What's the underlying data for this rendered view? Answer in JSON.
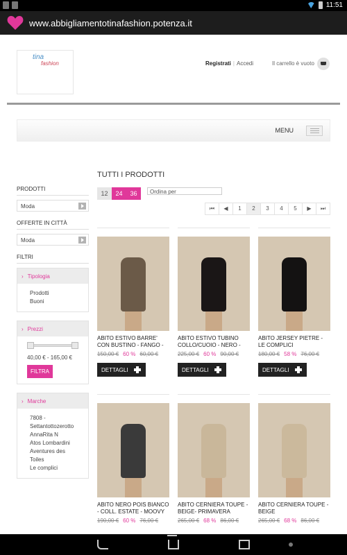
{
  "status_bar": {
    "time": "11:51"
  },
  "app": {
    "url": "www.abbigliamentotinafashion.potenza.it"
  },
  "header": {
    "logo_text_1": "tina",
    "logo_text_2": "fashion",
    "register_label": "Registrati",
    "login_label": "Accedi",
    "cart_label": "Il carrello è vuoto"
  },
  "menu": {
    "label": "MENU"
  },
  "sidebar": {
    "products_title": "PRODOTTI",
    "products_select": "Moda",
    "offers_title": "OFFERTE IN CITTÀ",
    "offers_select": "Moda",
    "filters_title": "FILTRI",
    "type_title": "Tipologia",
    "type_items": [
      "Prodotti",
      "Buoni"
    ],
    "prices_title": "Prezzi",
    "price_range": "40,00 € - 165,00 €",
    "filter_button": "FILTRA",
    "brands_title": "Marche",
    "brand_items": [
      "7808 - Settantottozerotto",
      "AnnaRita N",
      "Atos Lombardini",
      "Aventures des Toiles",
      "Le complici"
    ]
  },
  "main": {
    "title": "TUTTI I PRODOTTI",
    "per_page": [
      "12",
      "24",
      "36"
    ],
    "order_placeholder": "Ordina per",
    "pager": [
      "⏮",
      "◀",
      "1",
      "2",
      "3",
      "4",
      "5",
      "▶",
      "⏭"
    ],
    "detail_label": "DETTAGLI",
    "products": [
      {
        "name": "ABITO ESTIVO BARRE' CON BUSTINO - FANGO -",
        "old_price": "150,00 €",
        "discount": "60 %",
        "new_price": "60,00 €",
        "dress_color": "#6b5a48"
      },
      {
        "name": "ABITO ESTIVO TUBINO COLLO/CUOIO - NERO -",
        "old_price": "225,00 €",
        "discount": "60 %",
        "new_price": "90,00 €",
        "dress_color": "#1a1616"
      },
      {
        "name": "ABITO JERSEY PIETRE - LE COMPLICI",
        "old_price": "180,00 €",
        "discount": "58 %",
        "new_price": "76,00 €",
        "dress_color": "#141212"
      },
      {
        "name": "ABITO NERO POIS BIANCO - COLL. ESTATE - MOOVY",
        "old_price": "190,00 €",
        "discount": "60 %",
        "new_price": "76,00 €",
        "dress_color": "#3a3a3a"
      },
      {
        "name": "ABITO CERNIERA TOUPE - BEIGE- PRIMAVERA ESTATE -",
        "old_price": "265,00 €",
        "discount": "68 %",
        "new_price": "86,00 €",
        "dress_color": "#c9b79a"
      },
      {
        "name": "ABITO CERNIERA TOUPE - BEIGE",
        "old_price": "265,00 €",
        "discount": "68 %",
        "new_price": "86,00 €",
        "dress_color": "#cbb99c"
      }
    ]
  }
}
